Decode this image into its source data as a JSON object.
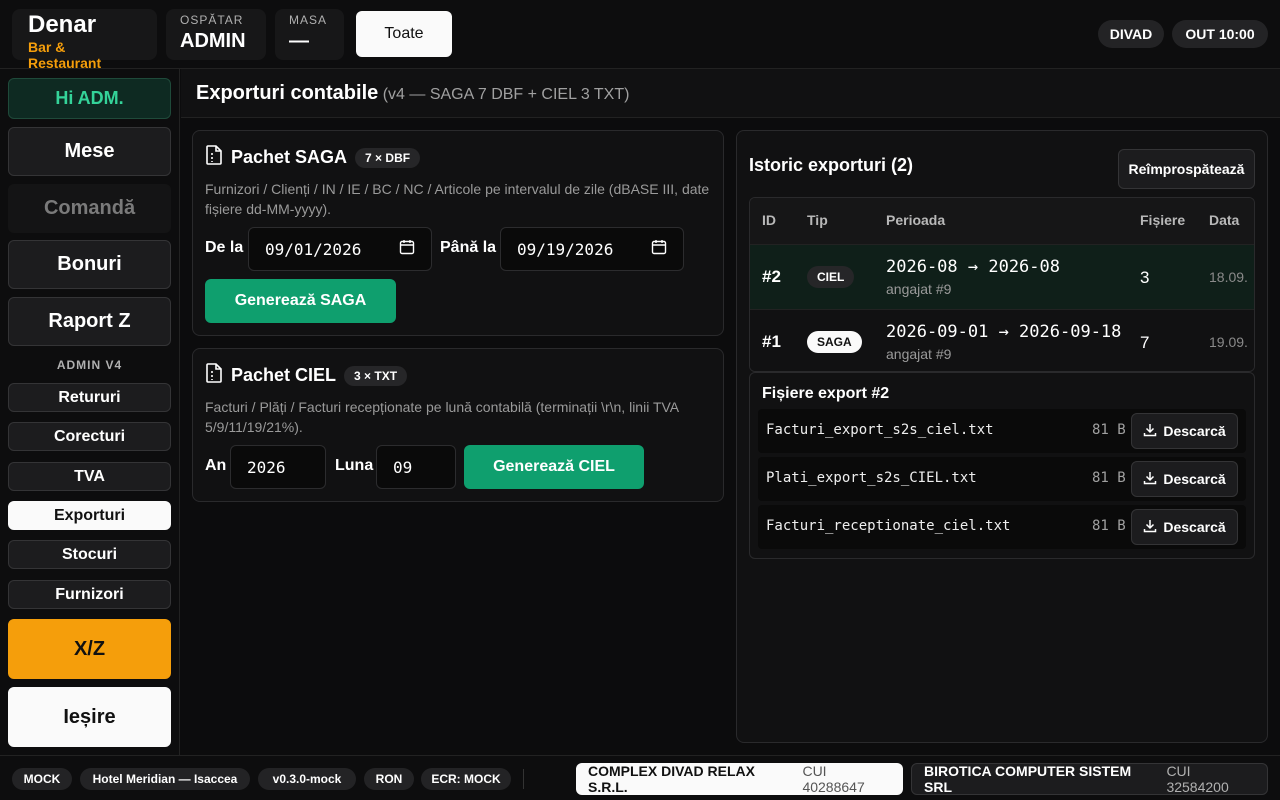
{
  "header": {
    "brand_name": "Denar",
    "brand_sub": "Bar & Restaurant",
    "waiter_label": "OSPĂTAR",
    "waiter_value": "ADMIN",
    "table_label": "MASA",
    "table_value": "—",
    "filter_button": "Toate",
    "location": "DIVAD",
    "shift": "OUT 10:00"
  },
  "sidebar": {
    "greeting": "Hi ADM.",
    "mese": "Mese",
    "comanda": "Comandă",
    "bonuri": "Bonuri",
    "raport_z": "Raport Z",
    "section_admin": "ADMIN V4",
    "retururi": "Retururi",
    "corecturi": "Corecturi",
    "tva": "TVA",
    "exporturi": "Exporturi",
    "stocuri": "Stocuri",
    "furnizori": "Furnizori",
    "xz": "X/Z",
    "iesire": "Ieșire"
  },
  "page": {
    "title": "Exporturi contabile",
    "subtitle": "(v4 — SAGA 7 DBF + CIEL 3 TXT)"
  },
  "saga": {
    "title": "Pachet SAGA",
    "chip": "7 × DBF",
    "desc": "Furnizori / Clienți / IN / IE / BC / NC / Articole pe intervalul de zile (dBASE III, date fișiere dd-MM-yyyy).",
    "from_label": "De la",
    "from_value": "09/01/2026",
    "to_label": "Până la",
    "to_value": "09/19/2026",
    "button": "Generează SAGA"
  },
  "ciel": {
    "title": "Pachet CIEL",
    "chip": "3 × TXT",
    "desc": "Facturi / Plăți / Facturi recepționate pe lună contabilă (terminații \\r\\n, linii TVA 5/9/11/19/21%).",
    "year_label": "An",
    "year_value": "2026",
    "month_label": "Luna",
    "month_value": "09",
    "button": "Generează CIEL"
  },
  "history": {
    "title": "Istoric exporturi (2)",
    "refresh": "Reîmprospătează",
    "columns": [
      "ID",
      "Tip",
      "Perioada",
      "Fișiere",
      "Data"
    ],
    "rows": [
      {
        "id": "#2",
        "type": "CIEL",
        "period": "2026-08 → 2026-08",
        "employee": "angajat #9",
        "files": "3",
        "date": "18.09."
      },
      {
        "id": "#1",
        "type": "SAGA",
        "period": "2026-09-01 → 2026-09-18",
        "employee": "angajat #9",
        "files": "7",
        "date": "19.09."
      }
    ]
  },
  "files_panel": {
    "title": "Fișiere export #2",
    "download_label": "Descarcă",
    "files": [
      {
        "name": "Facturi_export_s2s_ciel.txt",
        "size": "81 B"
      },
      {
        "name": "Plati_export_s2s_CIEL.txt",
        "size": "81 B"
      },
      {
        "name": "Facturi_receptionate_ciel.txt",
        "size": "81 B"
      }
    ]
  },
  "footer": {
    "mode": "MOCK",
    "hotel": "Hotel Meridian — Isaccea",
    "version": "v0.3.0-mock",
    "currency": "RON",
    "ecr": "ECR: MOCK",
    "company1_name": "COMPLEX DIVAD RELAX S.R.L.",
    "company1_cui": "CUI 40288647",
    "company2_name": "BIROTICA COMPUTER SISTEM SRL",
    "company2_cui": "CUI 32584200"
  }
}
